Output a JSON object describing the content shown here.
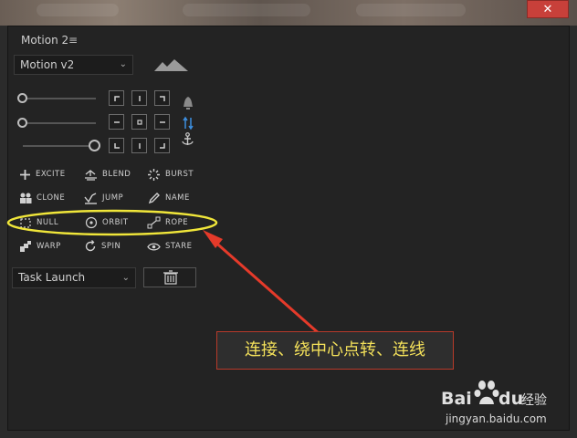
{
  "window": {
    "close_glyph": "✕"
  },
  "panel": {
    "title": "Motion 2",
    "menu_glyph": "≡"
  },
  "preset_select": {
    "value": "Motion v2",
    "icon": "mountains-icon"
  },
  "sliders": [
    {
      "value": 0.0
    },
    {
      "value": 0.0
    },
    {
      "value": 1.0
    }
  ],
  "side_icons": [
    "bell-icon",
    "link-arrows-icon",
    "anchor-icon"
  ],
  "actions": [
    {
      "label": "EXCITE",
      "icon": "plus-icon"
    },
    {
      "label": "BLEND",
      "icon": "blend-icon"
    },
    {
      "label": "BURST",
      "icon": "burst-icon"
    },
    {
      "label": "CLONE",
      "icon": "clone-icon"
    },
    {
      "label": "JUMP",
      "icon": "jump-icon"
    },
    {
      "label": "NAME",
      "icon": "pencil-icon"
    },
    {
      "label": "NULL",
      "icon": "null-icon"
    },
    {
      "label": "ORBIT",
      "icon": "orbit-icon"
    },
    {
      "label": "ROPE",
      "icon": "rope-icon"
    },
    {
      "label": "WARP",
      "icon": "warp-icon"
    },
    {
      "label": "SPIN",
      "icon": "spin-icon"
    },
    {
      "label": "STARE",
      "icon": "eye-icon"
    }
  ],
  "task_select": {
    "value": "Task Launch"
  },
  "trash": {
    "icon": "trash-icon"
  },
  "annotation": {
    "text": "连接、绕中心点转、连线",
    "color": "#f3e05a"
  },
  "watermark": {
    "brand_text": "Baidu经验",
    "url": "jingyan.baidu.com"
  },
  "colors": {
    "highlight": "#f0e63a",
    "arrow": "#e53a2a",
    "accent": "#c8403a"
  }
}
